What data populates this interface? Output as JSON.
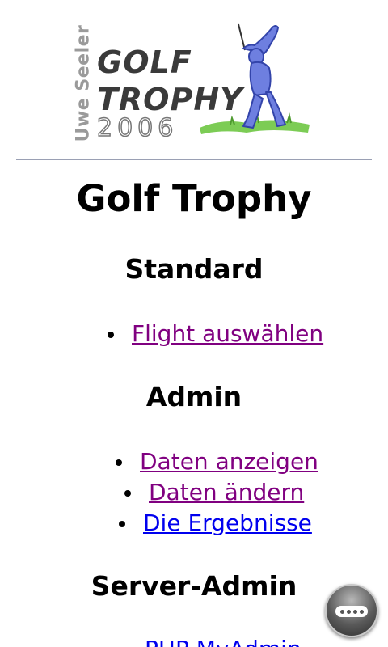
{
  "logo": {
    "author": "Uwe Seeler",
    "line1": "GOLF",
    "line2": "TROPHY",
    "year": "2006"
  },
  "page": {
    "title": "Golf Trophy"
  },
  "sections": {
    "standard": {
      "heading": "Standard",
      "links": [
        {
          "label": "Flight auswählen",
          "visited": true
        }
      ]
    },
    "admin": {
      "heading": "Admin",
      "links": [
        {
          "label": "Daten anzeigen",
          "visited": true
        },
        {
          "label": "Daten ändern",
          "visited": true
        },
        {
          "label": "Die Ergebnisse",
          "visited": false
        }
      ]
    },
    "server_admin": {
      "heading": "Server-Admin",
      "links": [
        {
          "label": "PHP MyAdmin",
          "visited": false
        }
      ]
    }
  },
  "colors": {
    "visited_link": "#800080",
    "unvisited_link": "#0000ee",
    "divider": "#9aa0b4",
    "golfer": "#6e7fe0",
    "grass": "#7ccc55"
  },
  "icons": {
    "menu_button": "menu-dots-icon"
  }
}
